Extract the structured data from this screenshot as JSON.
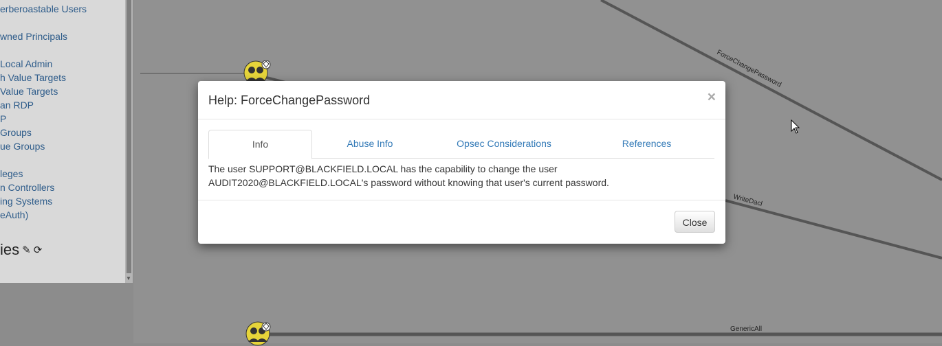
{
  "sidebar": {
    "queries": [
      "erberoastable Users",
      "wned Principals",
      "Local Admin",
      "h Value Targets",
      " Value Targets",
      "an RDP",
      "P",
      "Groups",
      "ue Groups",
      "leges",
      "n Controllers",
      "ing Systems",
      "eAuth)"
    ],
    "section_title": "ies",
    "edit_icon": "pencil-icon",
    "refresh_icon": "refresh-icon"
  },
  "graph": {
    "edge_labels": [
      "ForceChangePassword",
      "WriteDacl",
      "GenericAll"
    ],
    "node_icon": "user-group-icon",
    "node_badge_icon": "gem-icon"
  },
  "modal": {
    "title": "Help: ForceChangePassword",
    "close_x": "×",
    "tabs": [
      {
        "label": "Info",
        "active": true
      },
      {
        "label": "Abuse Info",
        "active": false
      },
      {
        "label": "Opsec Considerations",
        "active": false
      },
      {
        "label": "References",
        "active": false
      }
    ],
    "content": "The user SUPPORT@BLACKFIELD.LOCAL has the capability to change the user AUDIT2020@BLACKFIELD.LOCAL's password without knowing that user's current password.",
    "close_button": "Close"
  },
  "colors": {
    "link": "#337ab7",
    "sidebar_link": "#2e5c8a",
    "node_fill": "#e6d43a"
  }
}
